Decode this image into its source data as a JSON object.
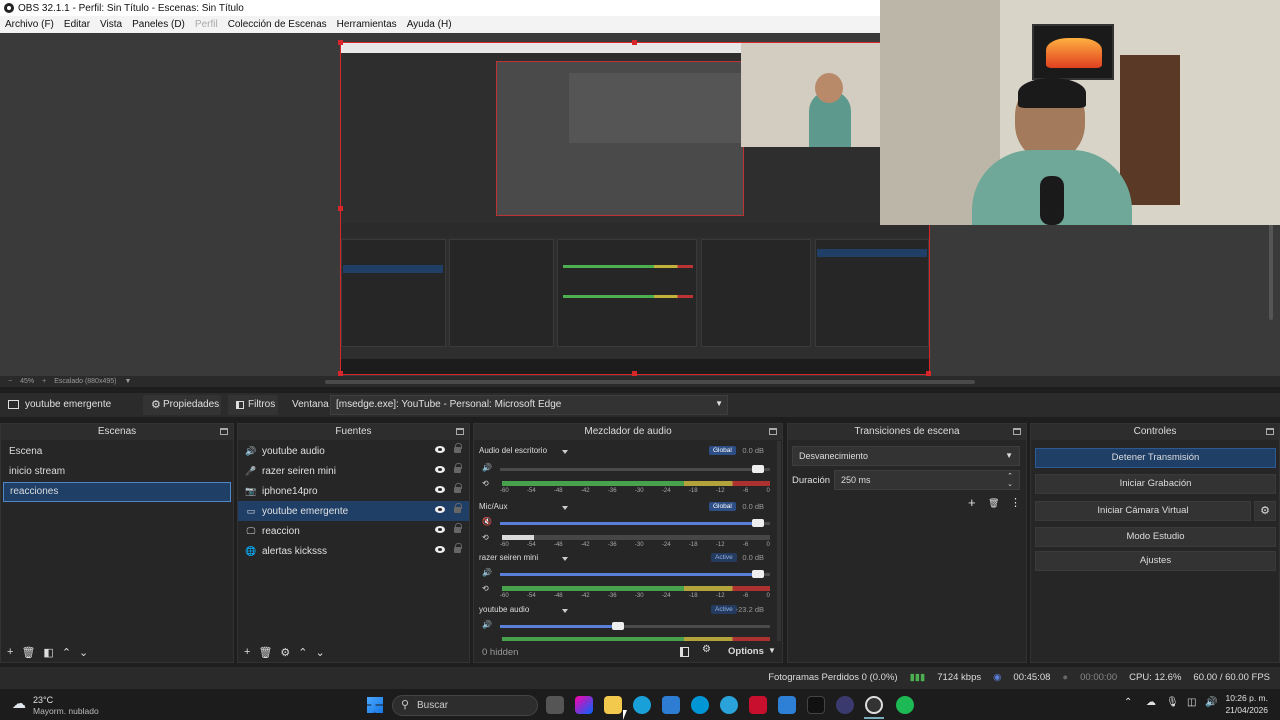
{
  "window": {
    "title": "OBS 32.1.1 - Perfil: Sin Título - Escenas: Sin Título"
  },
  "menu": [
    "Archivo (F)",
    "Editar",
    "Vista",
    "Paneles (D)",
    "Perfil",
    "Colección de Escenas",
    "Herramientas",
    "Ayuda (H)"
  ],
  "preview": {
    "zoom": "45%",
    "scale": "Escalado (880x495)"
  },
  "source_bar": {
    "selected_source": "youtube emergente",
    "properties": "Propiedades",
    "filters": "Filtros",
    "window_label": "Ventana",
    "window_value": "[msedge.exe]: YouTube - Personal: Microsoft Edge"
  },
  "scenes": {
    "title": "Escenas",
    "items": [
      "Escena",
      "inicio stream",
      "reacciones"
    ],
    "selected": 2
  },
  "sources": {
    "title": "Fuentes",
    "items": [
      {
        "name": "youtube audio",
        "icon": "speaker-icon"
      },
      {
        "name": "razer seiren mini",
        "icon": "microphone-icon"
      },
      {
        "name": "iphone14pro",
        "icon": "camera-icon"
      },
      {
        "name": "youtube emergente",
        "icon": "window-capture-icon"
      },
      {
        "name": "reaccion",
        "icon": "display-icon"
      },
      {
        "name": "alertas kicksss",
        "icon": "browser-icon"
      }
    ],
    "selected": 3
  },
  "mixer": {
    "title": "Mezclador de audio",
    "channels": [
      {
        "name": "Audio del escritorio",
        "badge": "Global",
        "db": "0.0 dB",
        "level": 0.97
      },
      {
        "name": "Mic/Aux",
        "badge": "Global",
        "db": "0.0 dB",
        "level": 0.97
      },
      {
        "name": "razer seiren mini",
        "badge": "Active",
        "db": "0.0 dB",
        "level": 0.97
      },
      {
        "name": "youtube audio",
        "badge": "Active",
        "db": "-23.2 dB",
        "level": 0.45
      }
    ],
    "ticks": [
      "-60",
      "-54",
      "-48",
      "-42",
      "-36",
      "-30",
      "-24",
      "-18",
      "-12",
      "-6",
      "0"
    ],
    "hidden": "0 hidden",
    "options": "Options"
  },
  "transitions": {
    "title": "Transiciones de escena",
    "type": "Desvanecimiento",
    "duration_label": "Duración",
    "duration_value": "250 ms"
  },
  "controls": {
    "title": "Controles",
    "buttons": [
      "Detener Transmisión",
      "Iniciar Grabación",
      "Iniciar Cámara Virtual",
      "Modo Estudio",
      "Ajustes"
    ]
  },
  "status": {
    "dropped": "Fotogramas Perdidos 0 (0.0%)",
    "bitrate": "7124 kbps",
    "stream_time": "00:45:08",
    "rec_time": "00:00:00",
    "cpu": "CPU: 12.6%",
    "fps": "60.00 / 60.00 FPS"
  },
  "taskbar": {
    "weather_temp": "23°C",
    "weather_desc": "Mayorm. nublado",
    "search": "Buscar",
    "time": "10:26 p. m.",
    "date": "21/04/2026"
  }
}
